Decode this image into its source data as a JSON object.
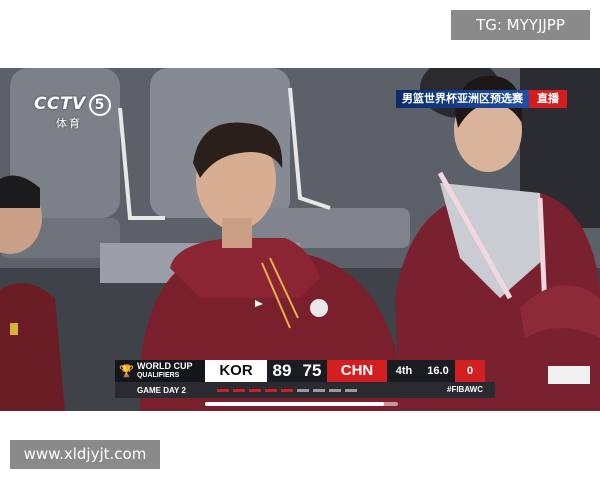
{
  "watermark_top": "TG: MYYJJPP",
  "watermark_bottom": "www.xldjyjt.com",
  "broadcast": {
    "channel_logo": "CCTV",
    "channel_number": "5",
    "channel_sub": "体育",
    "event_title": "男篮世界杯亚洲区预选赛",
    "live_label": "直播"
  },
  "scorebug": {
    "trophy_icon": "trophy-icon",
    "event_line1": "WORLD CUP",
    "event_line2": "QUALIFIERS",
    "game_day": "GAME DAY 2",
    "home_team": "KOR",
    "home_score": "89",
    "away_score": "75",
    "away_team": "CHN",
    "period": "4th",
    "clock": "16.0",
    "shot_clock": "0",
    "hashtag": "#FIBAWC",
    "home_color": "#ffffff",
    "away_color": "#d11f22"
  },
  "player": {
    "progress": 0.93
  }
}
